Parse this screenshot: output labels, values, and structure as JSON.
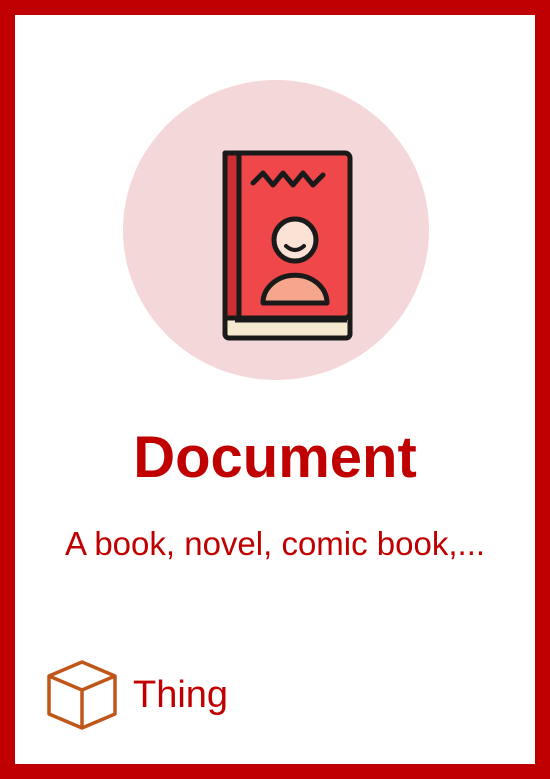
{
  "card": {
    "title": "Document",
    "description": "A book, novel, comic book,...",
    "type_label": "Thing",
    "main_icon": "book-with-person-icon",
    "type_icon": "cube-icon"
  },
  "colors": {
    "frame": "#c00000",
    "text": "#c00000",
    "icon_circle": "#f4d7d8",
    "book_cover": "#f0474a",
    "book_pages": "#f5ead0",
    "person_body": "#f5a68c",
    "cube": "#c0561a"
  }
}
